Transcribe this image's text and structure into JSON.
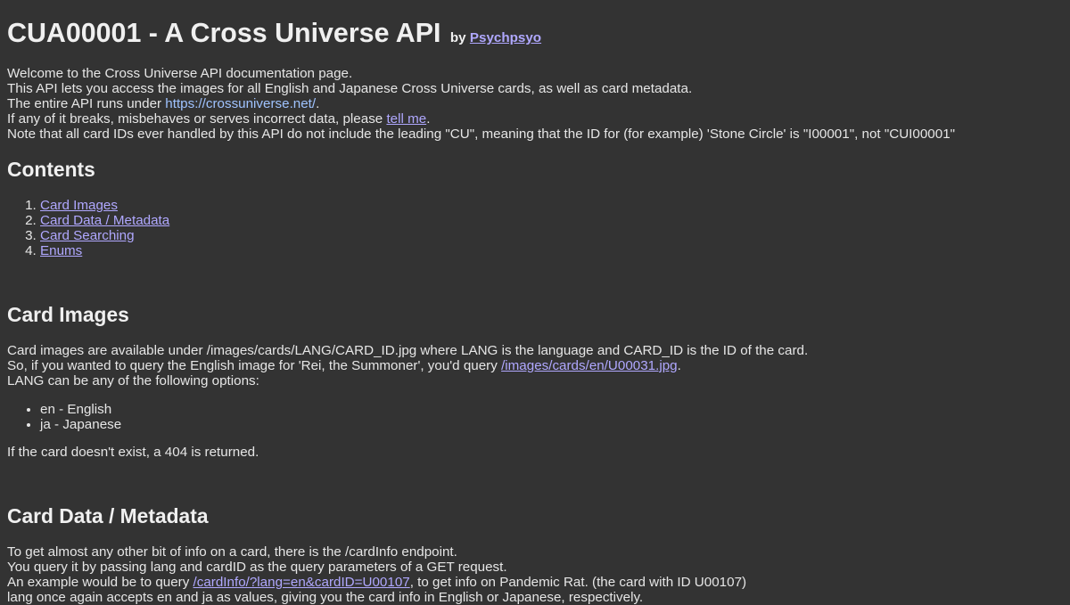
{
  "header": {
    "title": "CUA00001 - A Cross Universe API",
    "by_prefix": "by",
    "author_link": "Psychpsyo"
  },
  "intro": {
    "line1": "Welcome to the Cross Universe API documentation page.",
    "line2": "This API lets you access the images for all English and Japanese Cross Universe cards, as well as card metadata.",
    "line3_prefix": "The entire API runs under ",
    "line3_link": "https://crossuniverse.net/",
    "line3_suffix": ".",
    "line4_prefix": "If any of it breaks, misbehaves or serves incorrect data, please ",
    "line4_link": "tell me",
    "line4_suffix": ".",
    "line5": "Note that all card IDs ever handled by this API do not include the leading \"CU\", meaning that the ID for (for example) 'Stone Circle' is \"I00001\", not \"CUI00001\""
  },
  "contents": {
    "heading": "Contents",
    "items": [
      "Card Images",
      "Card Data / Metadata",
      "Card Searching",
      "Enums"
    ]
  },
  "card_images": {
    "heading": "Card Images",
    "line1": "Card images are available under /images/cards/LANG/CARD_ID.jpg where LANG is the language and CARD_ID is the ID of the card.",
    "line2_prefix": "So, if you wanted to query the English image for 'Rei, the Summoner', you'd query ",
    "line2_link": "/images/cards/en/U00031.jpg",
    "line2_suffix": ".",
    "line3": "LANG can be any of the following options:",
    "options": [
      "en - English",
      "ja - Japanese"
    ],
    "not_found": "If the card doesn't exist, a 404 is returned."
  },
  "card_data": {
    "heading": "Card Data / Metadata",
    "line1": "To get almost any other bit of info on a card, there is the /cardInfo endpoint.",
    "line2": "You query it by passing lang and cardID as the query parameters of a GET request.",
    "line3_prefix": "An example would be to query ",
    "line3_link": "/cardInfo/?lang=en&cardID=U00107",
    "line3_suffix": ", to get info on Pandemic Rat. (the card with ID U00107)",
    "line4": "lang once again accepts en and ja as values, giving you the card info in English or Japanese, respectively."
  },
  "colors": {
    "background": "#333333",
    "text": "#e6e6e6",
    "link": "#b0a8ff",
    "url_link": "#9fc3ff"
  }
}
